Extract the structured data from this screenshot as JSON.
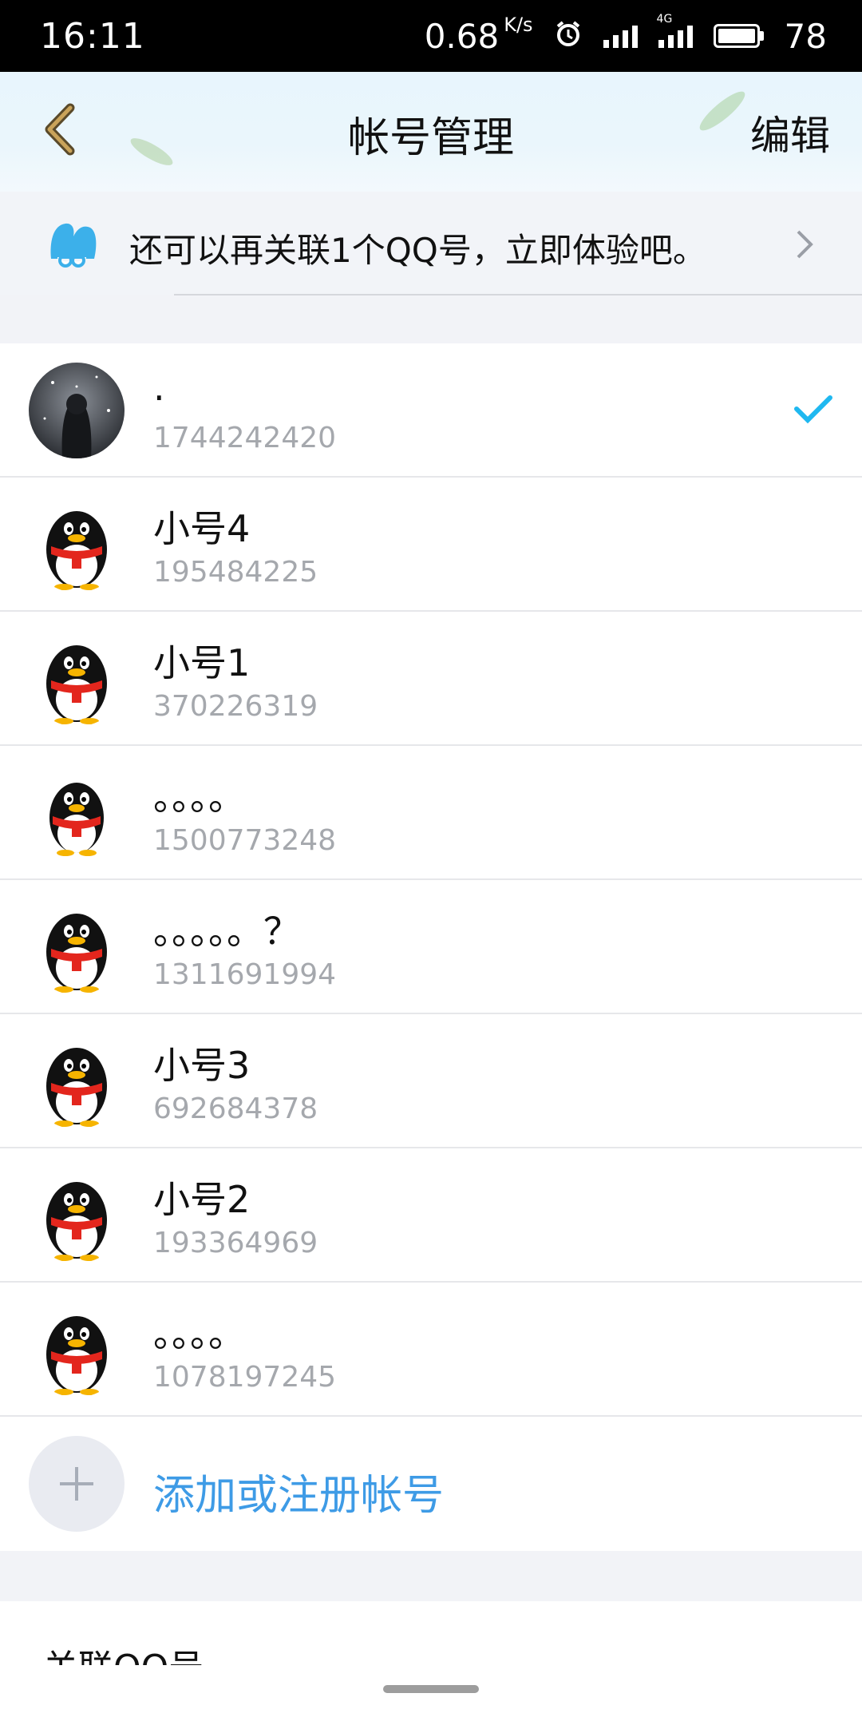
{
  "status_bar": {
    "time": "16:11",
    "net_speed": "0.68",
    "net_unit": "K/s",
    "network_type": "4G",
    "battery": "78",
    "icons": [
      "alarm-icon",
      "signal-icon",
      "signal-4g-icon",
      "battery-icon"
    ]
  },
  "header": {
    "title": "帐号管理",
    "edit_label": "编辑",
    "back_icon": "back-chevron-icon"
  },
  "promo": {
    "text": "还可以再关联1个QQ号，立即体验吧。",
    "icon": "qq-link-icon"
  },
  "accounts": [
    {
      "name": ".",
      "qq": "1744242420",
      "avatar": "photo-avatar",
      "selected": true
    },
    {
      "name": "小号4",
      "qq": "195484225",
      "avatar": "penguin-avatar"
    },
    {
      "name": "小号1",
      "qq": "370226319",
      "avatar": "penguin-avatar"
    },
    {
      "name": "。。。。",
      "qq": "1500773248",
      "avatar": "penguin-avatar"
    },
    {
      "name": "。。。。。？",
      "qq": "1311691994",
      "avatar": "penguin-avatar"
    },
    {
      "name": "小号3",
      "qq": "692684378",
      "avatar": "penguin-avatar"
    },
    {
      "name": "小号2",
      "qq": "193364969",
      "avatar": "penguin-avatar"
    },
    {
      "name": "。。。。",
      "qq": "1078197245",
      "avatar": "penguin-avatar"
    }
  ],
  "add_account": {
    "label": "添加或注册帐号",
    "icon": "plus-icon"
  },
  "bottom_card": {
    "partial_text": "关联QQ号"
  },
  "colors": {
    "accent": "#3e9be6",
    "check": "#1fb8f0",
    "secondary_text": "#a5a8ad"
  }
}
